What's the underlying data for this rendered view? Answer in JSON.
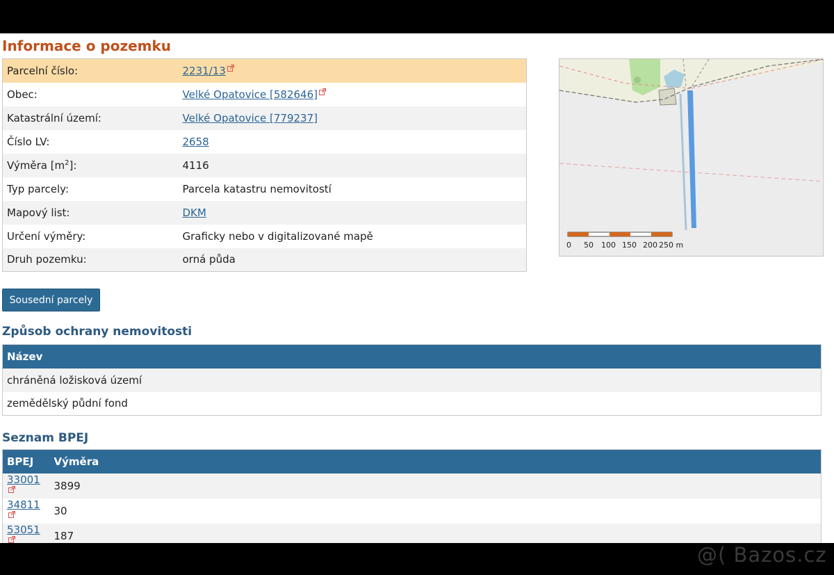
{
  "title": "Informace o pozemku",
  "info_rows": [
    {
      "label": "Parcelní číslo:",
      "value": "2231/13",
      "link": true,
      "external": true
    },
    {
      "label": "Obec:",
      "value": "Velké Opatovice [582646]",
      "link": true,
      "external": true
    },
    {
      "label": "Katastrální území:",
      "value": "Velké Opatovice [779237]",
      "link": true,
      "external": false
    },
    {
      "label": "Číslo LV:",
      "value": "2658",
      "link": true,
      "external": false
    },
    {
      "label": "Výměra [m",
      "label_sup": "2",
      "label_end": "]:",
      "value": "4116",
      "link": false,
      "external": false
    },
    {
      "label": "Typ parcely:",
      "value": "Parcela katastru nemovitostí",
      "link": false,
      "external": false
    },
    {
      "label": "Mapový list:",
      "value": "DKM",
      "link": true,
      "external": false
    },
    {
      "label": "Určení výměry:",
      "value": "Graficky nebo v digitalizované mapě",
      "link": false,
      "external": false
    },
    {
      "label": "Druh pozemku:",
      "value": "orná půda",
      "link": false,
      "external": false
    }
  ],
  "map": {
    "scale_labels": [
      "0",
      "50",
      "100",
      "150",
      "200",
      "250 m"
    ]
  },
  "neighbors_button": "Sousední parcely",
  "protection": {
    "heading": "Způsob ochrany nemovitosti",
    "column": "Název",
    "rows": [
      "chráněná ložisková území",
      "zemědělský půdní fond"
    ]
  },
  "bpej": {
    "heading": "Seznam BPEJ",
    "columns": [
      "BPEJ",
      "Výměra"
    ],
    "rows": [
      {
        "code": "33001",
        "area": "3899"
      },
      {
        "code": "34811",
        "area": "30"
      },
      {
        "code": "53051",
        "area": "187"
      }
    ]
  },
  "watermark": "@( Bazos.cz",
  "colors": {
    "heading_orange": "#c0501c",
    "heading_blue": "#2e5a80",
    "table_header": "#2e6a96",
    "highlight_row": "#fcdca6",
    "link": "#2a6496"
  }
}
